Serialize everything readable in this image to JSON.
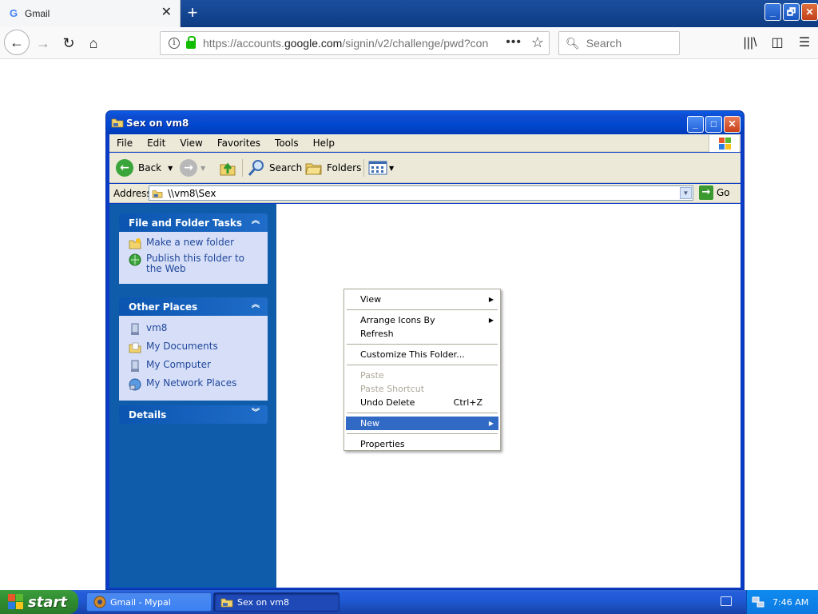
{
  "browser": {
    "tab_title": "Gmail",
    "tab_close": "✕",
    "new_tab": "+",
    "url_prefix": "https://accounts.",
    "url_host": "google.com",
    "url_path": "/signin/v2/challenge/pwd?con",
    "url_more": "•••",
    "search_placeholder": "Search",
    "window_controls": [
      "_",
      "🗗",
      "✕"
    ]
  },
  "explorer": {
    "title": "Sex on vm8",
    "menu": [
      "File",
      "Edit",
      "View",
      "Favorites",
      "Tools",
      "Help"
    ],
    "toolbar": {
      "back": "Back",
      "search": "Search",
      "folders": "Folders"
    },
    "address_label": "Address",
    "address_value": "\\\\vm8\\Sex",
    "go_label": "Go",
    "panels": [
      {
        "title": "File and Folder Tasks",
        "links": [
          "Make a new folder",
          "Publish this folder to the Web"
        ]
      },
      {
        "title": "Other Places",
        "links": [
          "vm8",
          "My Documents",
          "My Computer",
          "My Network Places"
        ]
      },
      {
        "title": "Details",
        "links": []
      }
    ]
  },
  "context_menu": {
    "items": [
      {
        "label": "View",
        "submenu": true
      },
      {
        "label": "Arrange Icons By",
        "submenu": true
      },
      {
        "label": "Refresh"
      },
      {
        "label": "Customize This Folder..."
      },
      {
        "label": "Paste",
        "disabled": true
      },
      {
        "label": "Paste Shortcut",
        "disabled": true
      },
      {
        "label": "Undo Delete",
        "shortcut": "Ctrl+Z"
      },
      {
        "label": "New",
        "submenu": true,
        "highlighted": true
      },
      {
        "label": "Properties"
      }
    ],
    "highlight_color": "#316ac5"
  },
  "taskbar": {
    "start_label": "start",
    "tasks": [
      {
        "label": "Gmail - Mypal",
        "active": false
      },
      {
        "label": "Sex on vm8",
        "active": true
      }
    ],
    "clock": "7:46 AM"
  },
  "colors": {
    "xp_blue": "#0a3cc8",
    "task_pane_blue": "#0f5cab",
    "link_blue": "#21479c",
    "start_green": "#2f8a2f"
  }
}
